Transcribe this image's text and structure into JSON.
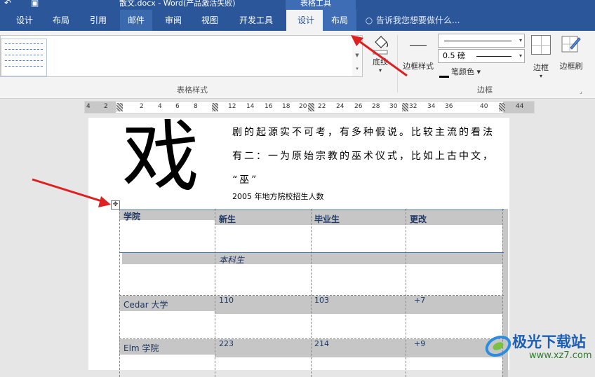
{
  "window": {
    "doc_title": "散文.docx - Word(产品激活失败)",
    "contextual_title": "表格工具"
  },
  "tabs": [
    {
      "label": "设计"
    },
    {
      "label": "布局"
    },
    {
      "label": "引用"
    },
    {
      "label": "邮件"
    },
    {
      "label": "审阅"
    },
    {
      "label": "视图"
    },
    {
      "label": "开发工具"
    },
    {
      "label": "设计"
    },
    {
      "label": "布局"
    }
  ],
  "tell_me": "告诉我您想要做什么...",
  "ribbon": {
    "table_styles_label": "表格样式",
    "shading_label": "底纹",
    "border_styles_label": "边框样式",
    "line_weight_value": "0.5 磅",
    "pen_color_label": "笔颜色",
    "borders_label": "边框",
    "border_painter_label": "边框刷",
    "borders_group_label": "边框"
  },
  "ruler_ticks": [
    "4",
    "2",
    "2",
    "4",
    "6",
    "8",
    "12",
    "14",
    "16",
    "18",
    "20",
    "22",
    "24",
    "26",
    "28",
    "30",
    "32",
    "34",
    "36",
    "40",
    "44"
  ],
  "document": {
    "big_char": "戏",
    "lines": [
      "剧的起源实不可考，有多种假说。比较主流的看法",
      "有二：一为原始宗教的巫术仪式，比如上古中文，",
      "“巫”"
    ],
    "caption": "2005 年地方院校招生人数",
    "table": {
      "headers": [
        "学院",
        "新生",
        "毕业生",
        "更改"
      ],
      "subheader": "本科生",
      "rows": [
        {
          "name": "Cedar 大学",
          "new": "110",
          "grad": "103",
          "change": "+7"
        },
        {
          "name": "Elm 学院",
          "new": "223",
          "grad": "214",
          "change": "+9"
        }
      ]
    }
  },
  "watermark": {
    "name": "极光下载站",
    "url": "www.xz7.com"
  },
  "colors": {
    "ribbon_blue": "#2b579a",
    "arrow_red": "#e02020",
    "table_text": "#1f3864"
  }
}
